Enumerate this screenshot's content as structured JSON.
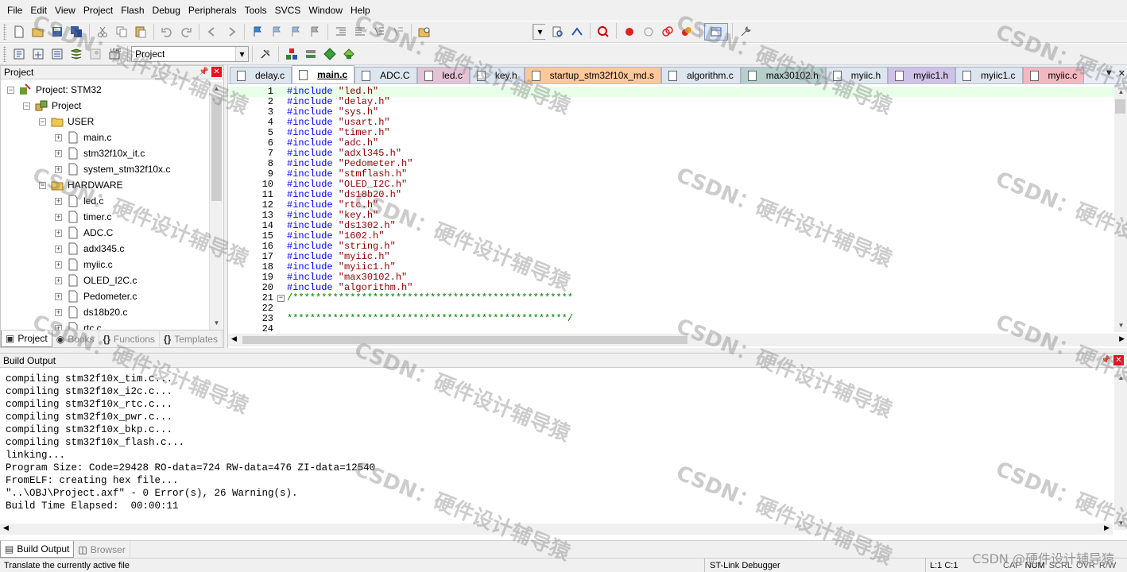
{
  "menu": [
    "File",
    "Edit",
    "View",
    "Project",
    "Flash",
    "Debug",
    "Peripherals",
    "Tools",
    "SVCS",
    "Window",
    "Help"
  ],
  "toolbar2": {
    "target_select": "Project"
  },
  "project_panel": {
    "title": "Project",
    "tree": [
      {
        "label": "Project: STM32",
        "level": 0,
        "icon": "project-icon",
        "expander": "−"
      },
      {
        "label": "Project",
        "level": 1,
        "icon": "target-icon",
        "expander": "−"
      },
      {
        "label": "USER",
        "level": 2,
        "icon": "folder-icon",
        "expander": "−"
      },
      {
        "label": "main.c",
        "level": 3,
        "icon": "file-icon",
        "expander": "+"
      },
      {
        "label": "stm32f10x_it.c",
        "level": 3,
        "icon": "file-icon",
        "expander": "+"
      },
      {
        "label": "system_stm32f10x.c",
        "level": 3,
        "icon": "file-icon",
        "expander": "+"
      },
      {
        "label": "HARDWARE",
        "level": 2,
        "icon": "folder-icon",
        "expander": "−"
      },
      {
        "label": "led.c",
        "level": 3,
        "icon": "file-icon",
        "expander": "+"
      },
      {
        "label": "timer.c",
        "level": 3,
        "icon": "file-icon",
        "expander": "+"
      },
      {
        "label": "ADC.C",
        "level": 3,
        "icon": "file-icon",
        "expander": "+"
      },
      {
        "label": "adxl345.c",
        "level": 3,
        "icon": "file-icon",
        "expander": "+"
      },
      {
        "label": "myiic.c",
        "level": 3,
        "icon": "file-icon",
        "expander": "+"
      },
      {
        "label": "OLED_I2C.c",
        "level": 3,
        "icon": "file-icon",
        "expander": "+"
      },
      {
        "label": "Pedometer.c",
        "level": 3,
        "icon": "file-icon",
        "expander": "+"
      },
      {
        "label": "ds18b20.c",
        "level": 3,
        "icon": "file-icon",
        "expander": "+"
      },
      {
        "label": "rtc.c",
        "level": 3,
        "icon": "file-icon",
        "expander": "+"
      }
    ],
    "tabs": [
      {
        "label": "Project",
        "icon": "project-tab-icon",
        "active": true
      },
      {
        "label": "Books",
        "icon": "books-icon",
        "active": false
      },
      {
        "label": "Functions",
        "icon": "functions-icon",
        "active": false
      },
      {
        "label": "Templates",
        "icon": "templates-icon",
        "active": false
      }
    ]
  },
  "editor": {
    "tabs": [
      {
        "label": "delay.c",
        "color": "#dde5ef",
        "active": false
      },
      {
        "label": "main.c",
        "color": "#ffffff",
        "active": true
      },
      {
        "label": "ADC.C",
        "color": "#dde5ef",
        "active": false
      },
      {
        "label": "led.c",
        "color": "#e5c3d6",
        "active": false
      },
      {
        "label": "key.h",
        "color": "#dde5ef",
        "active": false
      },
      {
        "label": "startup_stm32f10x_md.s",
        "color": "#ffc89a",
        "active": false
      },
      {
        "label": "algorithm.c",
        "color": "#dde5ef",
        "active": false
      },
      {
        "label": "max30102.h",
        "color": "#b6cfcb",
        "active": false
      },
      {
        "label": "myiic.h",
        "color": "#dde5ef",
        "active": false
      },
      {
        "label": "myiic1.h",
        "color": "#cfc2e8",
        "active": false
      },
      {
        "label": "myiic1.c",
        "color": "#dde5ef",
        "active": false
      },
      {
        "label": "myiic.c",
        "color": "#f2b8c0",
        "active": false
      }
    ],
    "lines": [
      {
        "n": "1",
        "kw": "#include",
        "str": " \"led.h\"",
        "cm": ""
      },
      {
        "n": "2",
        "kw": "#include",
        "str": " \"delay.h\"",
        "cm": ""
      },
      {
        "n": "3",
        "kw": "#include",
        "str": " \"sys.h\"",
        "cm": ""
      },
      {
        "n": "4",
        "kw": "#include",
        "str": " \"usart.h\"",
        "cm": ""
      },
      {
        "n": "5",
        "kw": "#include",
        "str": " \"timer.h\"",
        "cm": ""
      },
      {
        "n": "6",
        "kw": "#include",
        "str": " \"adc.h\"",
        "cm": ""
      },
      {
        "n": "7",
        "kw": "#include",
        "str": " \"adxl345.h\"",
        "cm": ""
      },
      {
        "n": "8",
        "kw": "#include",
        "str": " \"Pedometer.h\"",
        "cm": ""
      },
      {
        "n": "9",
        "kw": "#include",
        "str": " \"stmflash.h\"",
        "cm": ""
      },
      {
        "n": "10",
        "kw": "#include",
        "str": " \"OLED_I2C.h\"",
        "cm": ""
      },
      {
        "n": "11",
        "kw": "#include",
        "str": " \"ds18b20.h\"",
        "cm": ""
      },
      {
        "n": "12",
        "kw": "#include",
        "str": " \"rtc.h\"",
        "cm": ""
      },
      {
        "n": "13",
        "kw": "#include",
        "str": " \"key.h\"",
        "cm": ""
      },
      {
        "n": "14",
        "kw": "#include",
        "str": " \"ds1302.h\"",
        "cm": ""
      },
      {
        "n": "15",
        "kw": "#include",
        "str": " \"1602.h\"",
        "cm": ""
      },
      {
        "n": "16",
        "kw": "#include",
        "str": " \"string.h\"",
        "cm": ""
      },
      {
        "n": "17",
        "kw": "#include",
        "str": " \"myiic.h\"",
        "cm": ""
      },
      {
        "n": "18",
        "kw": "#include",
        "str": " \"myiic1.h\"",
        "cm": ""
      },
      {
        "n": "19",
        "kw": "#include",
        "str": " \"max30102.h\"",
        "cm": ""
      },
      {
        "n": "20",
        "kw": "#include",
        "str": " \"algorithm.h\"",
        "cm": ""
      },
      {
        "n": "21",
        "kw": "",
        "str": "",
        "cm": "/*************************************************"
      },
      {
        "n": "22",
        "kw": "",
        "str": "",
        "cm": ""
      },
      {
        "n": "23",
        "kw": "",
        "str": "",
        "cm": "*************************************************/"
      },
      {
        "n": "24",
        "kw": "",
        "str": "",
        "cm": ""
      }
    ]
  },
  "build_output": {
    "title": "Build Output",
    "lines": [
      "compiling stm32f10x_tim.c...",
      "compiling stm32f10x_i2c.c...",
      "compiling stm32f10x_rtc.c...",
      "compiling stm32f10x_pwr.c...",
      "compiling stm32f10x_bkp.c...",
      "compiling stm32f10x_flash.c...",
      "linking...",
      "Program Size: Code=29428 RO-data=724 RW-data=476 ZI-data=12540",
      "FromELF: creating hex file...",
      "\"..\\OBJ\\Project.axf\" - 0 Error(s), 26 Warning(s).",
      "Build Time Elapsed:  00:00:11"
    ],
    "tabs": [
      {
        "label": "Build Output",
        "active": true
      },
      {
        "label": "Browser",
        "active": false
      }
    ]
  },
  "status": {
    "hint": "Translate the currently active file",
    "debugger": "ST-Link Debugger",
    "position": "L:1 C:1",
    "indicators": [
      "CAP",
      "NUM",
      "SCRL",
      "OVR",
      "R/W"
    ]
  },
  "watermark": {
    "text": "CSDN：硬件设计辅导猿",
    "corner": "CSDN @硬件设计辅导猿"
  },
  "colors": {
    "keyword": "#0000ff",
    "string": "#8b0000",
    "comment": "#008000",
    "current_line": "#e8ffe8"
  }
}
